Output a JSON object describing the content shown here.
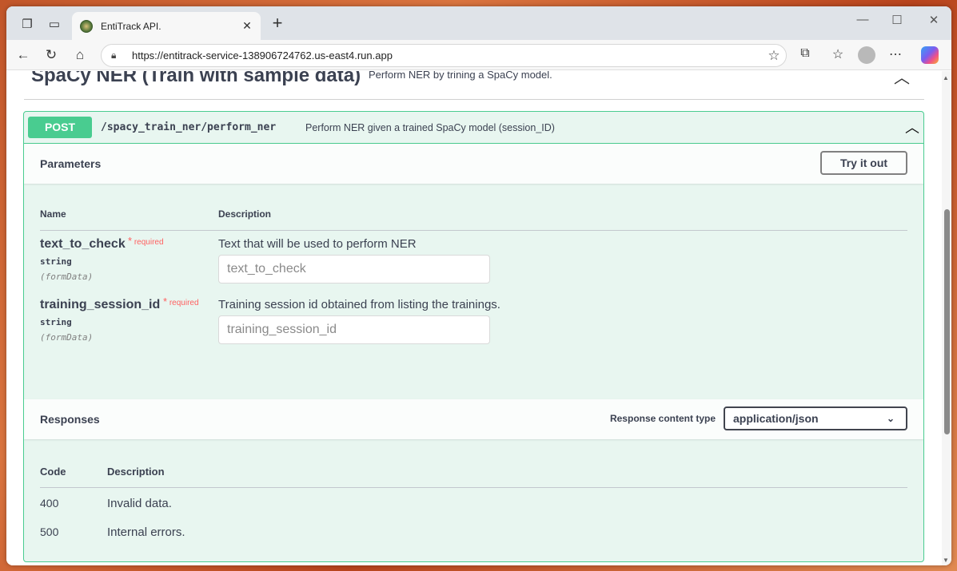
{
  "browser": {
    "tab_title": "EntiTrack API.",
    "tab_close": "✕",
    "new_tab": "+",
    "url": "https://entitrack-service-138906724762.us-east4.run.app"
  },
  "section": {
    "title": "SpaCy NER (Train with sample data)",
    "description": "Perform NER by trining a SpaCy model."
  },
  "operation": {
    "method": "POST",
    "path": "/spacy_train_ner/perform_ner",
    "description": "Perform NER given a trained SpaCy model (session_ID)"
  },
  "parameters": {
    "title": "Parameters",
    "try_button": "Try it out",
    "col_name": "Name",
    "col_description": "Description",
    "required_star": "*",
    "required_label": "required",
    "items": [
      {
        "name": "text_to_check",
        "type": "string",
        "in": "(formData)",
        "description": "Text that will be used to perform NER",
        "placeholder": "text_to_check"
      },
      {
        "name": "training_session_id",
        "type": "string",
        "in": "(formData)",
        "description": "Training session id obtained from listing the trainings.",
        "placeholder": "training_session_id"
      }
    ]
  },
  "responses": {
    "title": "Responses",
    "content_type_label": "Response content type",
    "content_type_value": "application/json",
    "col_code": "Code",
    "col_description": "Description",
    "items": [
      {
        "code": "400",
        "description": "Invalid data."
      },
      {
        "code": "500",
        "description": "Internal errors."
      }
    ]
  },
  "colors": {
    "post_green": "#49cc90",
    "op_background": "#e8f6f0",
    "required_red": "#ff6060"
  }
}
